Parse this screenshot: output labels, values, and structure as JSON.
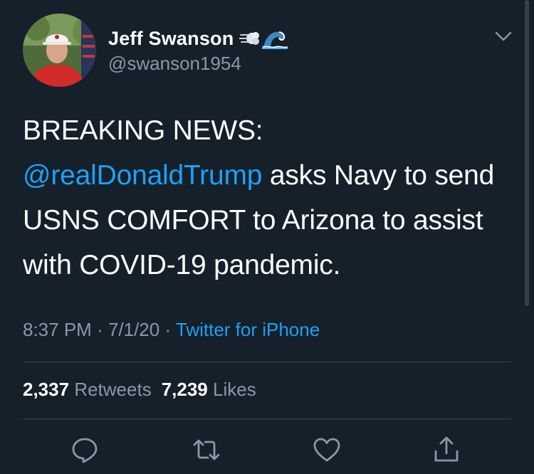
{
  "author": {
    "display_name": "Jeff Swanson",
    "handle": "@swanson1954",
    "name_emojis": [
      "dash-emoji-icon",
      "water-wave-emoji-icon"
    ]
  },
  "tweet": {
    "line1": "BREAKING NEWS:",
    "mention": "@realDonaldTrump",
    "rest": " asks Navy to send USNS COMFORT to Arizona to assist with COVID-19 pandemic."
  },
  "meta": {
    "time": "8:37 PM",
    "sep1": " · ",
    "date": "7/1/20",
    "sep2": " · ",
    "source": "Twitter for iPhone"
  },
  "stats": {
    "retweets_count": "2,337",
    "retweets_label": "Retweets",
    "likes_count": "7,239",
    "likes_label": "Likes"
  },
  "icons": [
    "reply-icon",
    "retweet-icon",
    "like-icon",
    "share-icon",
    "chevron-down-icon"
  ],
  "colors": {
    "background": "#15202b",
    "text": "#ffffff",
    "secondary": "#8899a6",
    "accent": "#1da1f2",
    "divider": "#38444d"
  }
}
